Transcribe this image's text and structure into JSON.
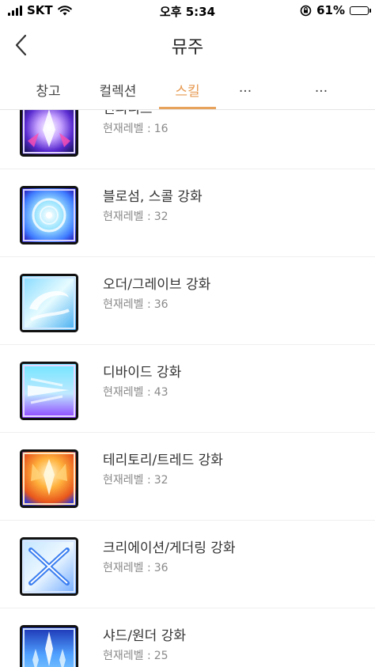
{
  "status": {
    "carrier": "SKT",
    "time": "오후 5:34",
    "battery": "61%",
    "battery_level": 0.61
  },
  "header": {
    "title": "뮤주"
  },
  "tabs": [
    {
      "label": "창고",
      "active": false
    },
    {
      "label": "컬렉션",
      "active": false
    },
    {
      "label": "스킬",
      "active": true
    },
    {
      "label": "...",
      "active": false
    },
    {
      "label": "...",
      "active": false
    }
  ],
  "level_label": "현재레벨 :",
  "skills": [
    {
      "name": "인피니트",
      "level": "16",
      "icon": "infinite-skill-icon"
    },
    {
      "name": "블로섬, 스콜 강화",
      "level": "32",
      "icon": "blossom-squall-skill-icon"
    },
    {
      "name": "오더/그레이브 강화",
      "level": "36",
      "icon": "order-grave-skill-icon"
    },
    {
      "name": "디바이드 강화",
      "level": "43",
      "icon": "divide-skill-icon"
    },
    {
      "name": "테리토리/트레드 강화",
      "level": "32",
      "icon": "territory-tread-skill-icon"
    },
    {
      "name": "크리에이션/게더링 강화",
      "level": "36",
      "icon": "creation-gathering-skill-icon"
    },
    {
      "name": "샤드/원더 강화",
      "level": "25",
      "icon": "shard-wonder-skill-icon"
    }
  ],
  "colors": {
    "accent": "#e7a25c",
    "level_text": "#8a8a8a",
    "name_text": "#333333"
  }
}
